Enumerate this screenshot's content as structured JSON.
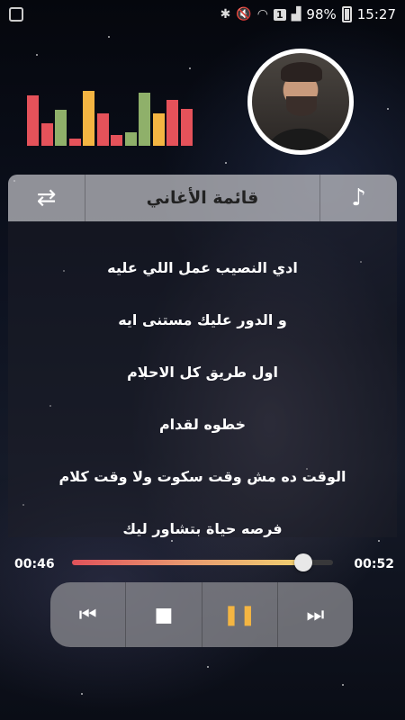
{
  "status_bar": {
    "time": "15:27",
    "battery_percent": "98%",
    "sim_badge": "1",
    "icons": [
      "bluetooth-icon",
      "mute-icon",
      "wifi-icon",
      "signal-icon",
      "battery-icon"
    ]
  },
  "visualizer": {
    "bars": [
      {
        "color": "#e5525a",
        "level": 0.85
      },
      {
        "color": "#e5525a",
        "level": 0.38
      },
      {
        "color": "#8fb06a",
        "level": 0.6
      },
      {
        "color": "#e5525a",
        "level": 0.12
      },
      {
        "color": "#f4b542",
        "level": 0.92
      },
      {
        "color": "#e5525a",
        "level": 0.55
      },
      {
        "color": "#e5525a",
        "level": 0.18
      },
      {
        "color": "#8fb06a",
        "level": 0.22
      },
      {
        "color": "#8fb06a",
        "level": 0.9
      },
      {
        "color": "#f4b542",
        "level": 0.55
      },
      {
        "color": "#e5525a",
        "level": 0.78
      },
      {
        "color": "#e5525a",
        "level": 0.62
      }
    ]
  },
  "header": {
    "title": "قائمة الأغاني",
    "left_icon": "repeat-icon",
    "right_icon": "music-note-icon"
  },
  "lyrics": [
    "ادي النصيب عمل اللي عليه",
    "و الدور عليك مستنى ايه",
    "اول طريق كل الاحلام",
    "خطوه لقدام",
    "الوقت ده مش وقت سكوت ولا وقت كلام",
    "فرصه حياة بتشاور ليك"
  ],
  "player": {
    "current_time": "00:46",
    "total_time": "00:52",
    "progress": 0.885
  },
  "controls": {
    "previous_icon": "skip-previous-icon",
    "stop_icon": "stop-icon",
    "pause_icon": "pause-icon",
    "next_icon": "skip-next-icon",
    "accent_color": "#f4b542"
  }
}
